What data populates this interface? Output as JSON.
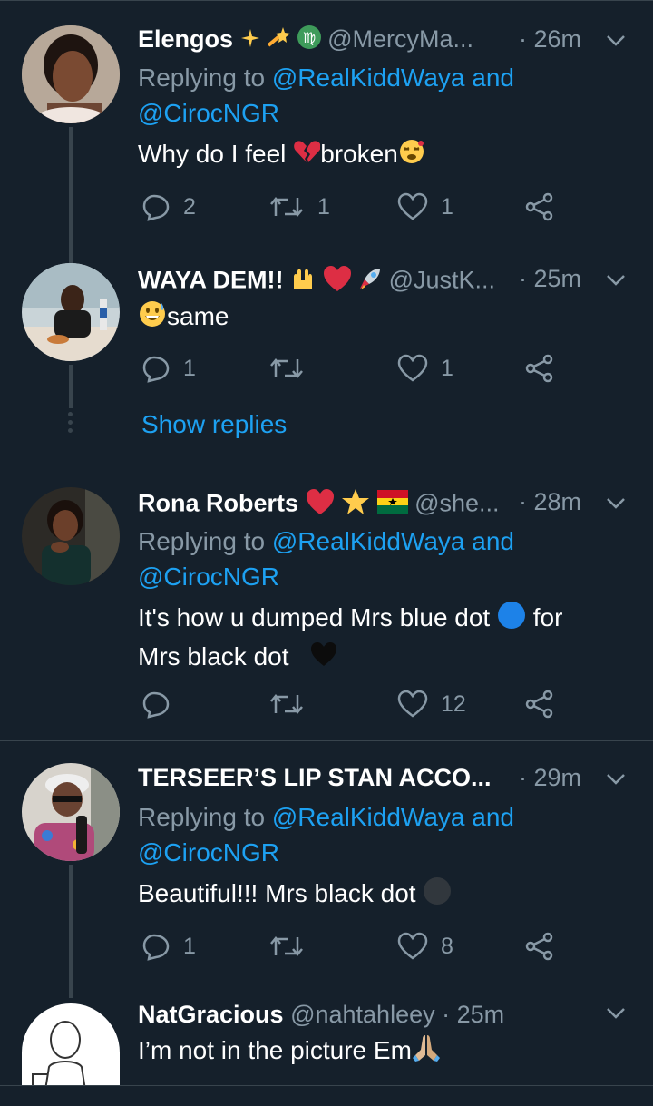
{
  "tweets": [
    {
      "name": "Elengos",
      "handle": "@MercyMa...",
      "time": "· 26m",
      "replying_prefix": "Replying to ",
      "replying_user1": "@RealKiddWaya",
      "replying_and": " and",
      "replying_user2": "@CirocNGR",
      "text_part1": "Why do I feel ",
      "text_part2": "broken",
      "replies": "2",
      "retweets": "1",
      "likes": "1"
    },
    {
      "name": "WAYA DEM!!",
      "handle": "@JustK...",
      "time": "· 25m",
      "text_part1": "same",
      "replies": "1",
      "retweets": "",
      "likes": "1",
      "show_replies": "Show replies"
    },
    {
      "name": "Rona Roberts",
      "handle": "@she...",
      "time": "· 28m",
      "replying_prefix": "Replying to ",
      "replying_user1": "@RealKiddWaya",
      "replying_and": " and",
      "replying_user2": "@CirocNGR",
      "text_part1": "It's how u dumped Mrs blue dot ",
      "text_part2": " for",
      "text_line2": "Mrs black dot ",
      "replies": "",
      "retweets": "",
      "likes": "12"
    },
    {
      "name": "TERSEER’S LIP STAN ACCO...",
      "handle": "",
      "time": "· 29m",
      "replying_prefix": "Replying to ",
      "replying_user1": "@RealKiddWaya",
      "replying_and": " and",
      "replying_user2": "@CirocNGR",
      "text_part1": "Beautiful!!!  Mrs black dot ",
      "replies": "1",
      "retweets": "",
      "likes": "8"
    },
    {
      "name": "NatGracious",
      "handle": "@nahtahleey",
      "time": "· 25m",
      "text_part1": "I’m not in the picture Em"
    }
  ],
  "colors": {
    "background": "#15202b",
    "secondary_text": "#8899a6",
    "link": "#1da1f2",
    "divider": "#38444d"
  },
  "icons": [
    "reply-icon",
    "retweet-icon",
    "like-icon",
    "share-icon",
    "chevron-down-icon"
  ]
}
